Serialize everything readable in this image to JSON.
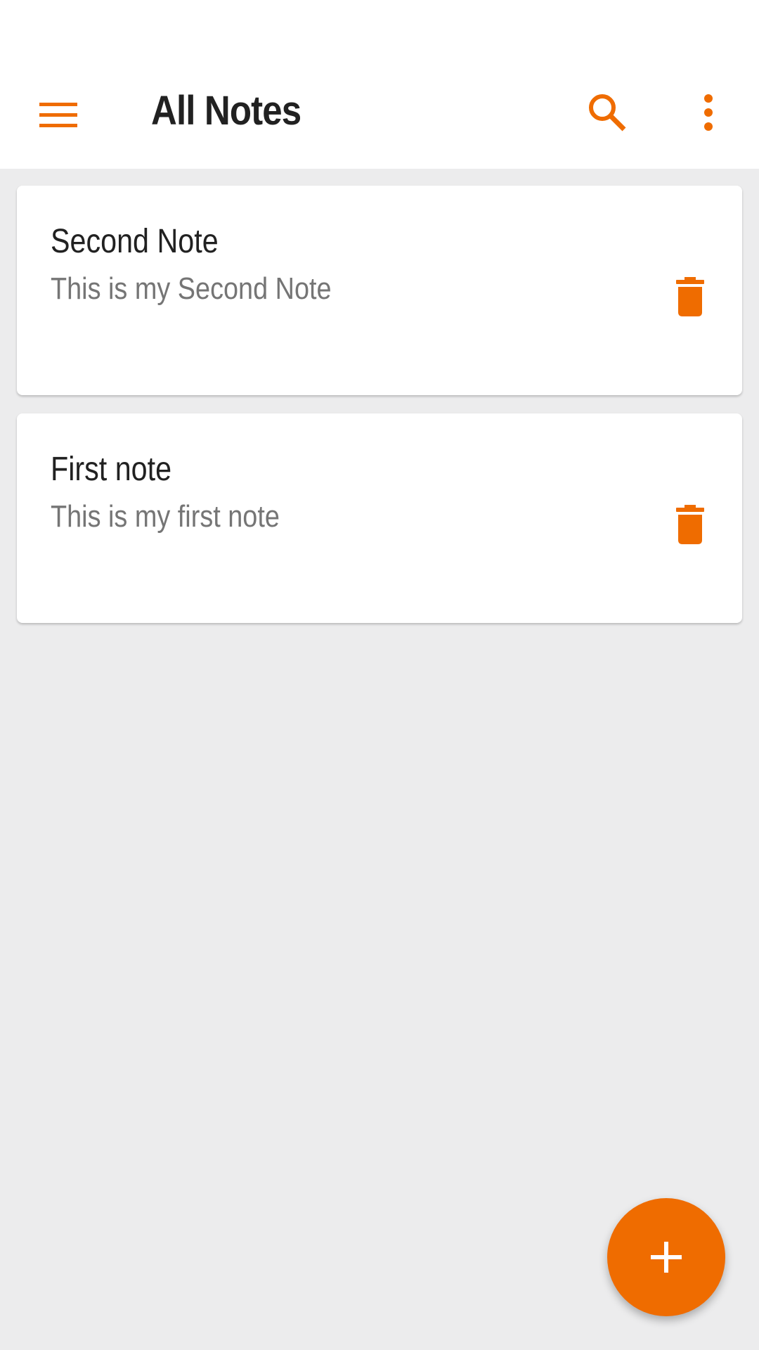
{
  "colors": {
    "accent": "#ef6c00",
    "background": "#ececed",
    "surface": "#ffffff",
    "title_text": "#212121",
    "secondary_text": "#757575"
  },
  "toolbar": {
    "title": "All Notes",
    "menu_icon": "menu-icon",
    "search_icon": "search-icon",
    "more_icon": "more-vert-icon"
  },
  "notes": [
    {
      "title": "Second Note",
      "body": "This is my Second Note",
      "action_icon": "delete-icon"
    },
    {
      "title": "First note",
      "body": "This is my first note",
      "action_icon": "delete-icon"
    }
  ],
  "fab": {
    "icon": "add-icon"
  }
}
